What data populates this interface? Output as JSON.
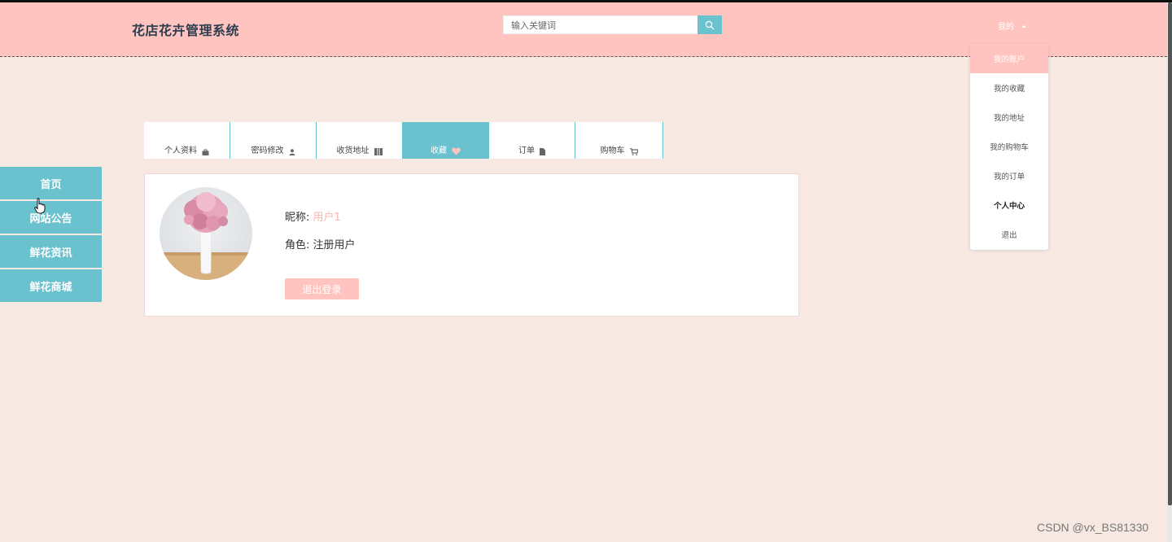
{
  "header": {
    "title": "花店花卉管理系统",
    "search_placeholder": "输入关键词",
    "user_menu_label": "我的"
  },
  "dropdown": {
    "items": [
      "我的账户",
      "我的收藏",
      "我的地址",
      "我的购物车",
      "我的订单",
      "个人中心",
      "退出"
    ]
  },
  "sidebar": {
    "items": [
      "首页",
      "网站公告",
      "鲜花资讯",
      "鲜花商城"
    ]
  },
  "tabs": [
    {
      "label": "个人资料",
      "icon": "bag-icon"
    },
    {
      "label": "密码修改",
      "icon": "user-icon"
    },
    {
      "label": "收货地址",
      "icon": "map-icon"
    },
    {
      "label": "收藏",
      "icon": "heart-icon",
      "active": true
    },
    {
      "label": "订单",
      "icon": "document-icon"
    },
    {
      "label": "购物车",
      "icon": "cart-icon"
    }
  ],
  "profile": {
    "nickname_label": "昵称: ",
    "nickname_value": "用户1",
    "role_label": "角色: ",
    "role_value": "注册用户",
    "logout_label": "退出登录"
  },
  "watermark": "CSDN @vx_BS81330",
  "colors": {
    "header_bg": "#ffc4c0",
    "accent": "#6ac2cf",
    "page_bg": "#f7e8e2",
    "nickname_value": "#ffb3b0"
  }
}
